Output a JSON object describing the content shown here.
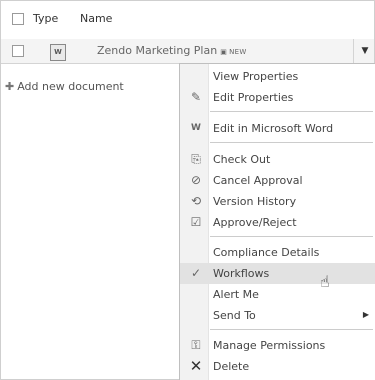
{
  "list": {
    "headers": {
      "type": "Type",
      "name": "Name"
    },
    "row": {
      "title": "Zendo Marketing Plan",
      "new_badge": "NEW",
      "file_type_icon": "word-doc-icon"
    },
    "add_new": "Add new document"
  },
  "menu": {
    "items": [
      {
        "label": "View Properties",
        "icon": ""
      },
      {
        "label": "Edit Properties",
        "icon": "edit-properties-icon"
      },
      {
        "label": "Edit in Microsoft Word",
        "icon": "word-doc-icon"
      },
      {
        "label": "Check Out",
        "icon": "check-out-icon"
      },
      {
        "label": "Cancel Approval",
        "icon": "cancel-approval-icon"
      },
      {
        "label": "Version History",
        "icon": "version-history-icon"
      },
      {
        "label": "Approve/Reject",
        "icon": "approve-reject-icon"
      },
      {
        "label": "Compliance Details",
        "icon": ""
      },
      {
        "label": "Workflows",
        "icon": "workflow-icon"
      },
      {
        "label": "Alert Me",
        "icon": ""
      },
      {
        "label": "Send To",
        "icon": "",
        "has_submenu": true
      },
      {
        "label": "Manage Permissions",
        "icon": "manage-permissions-icon"
      },
      {
        "label": "Delete",
        "icon": "delete-icon"
      }
    ],
    "highlighted_item": "Workflows"
  }
}
